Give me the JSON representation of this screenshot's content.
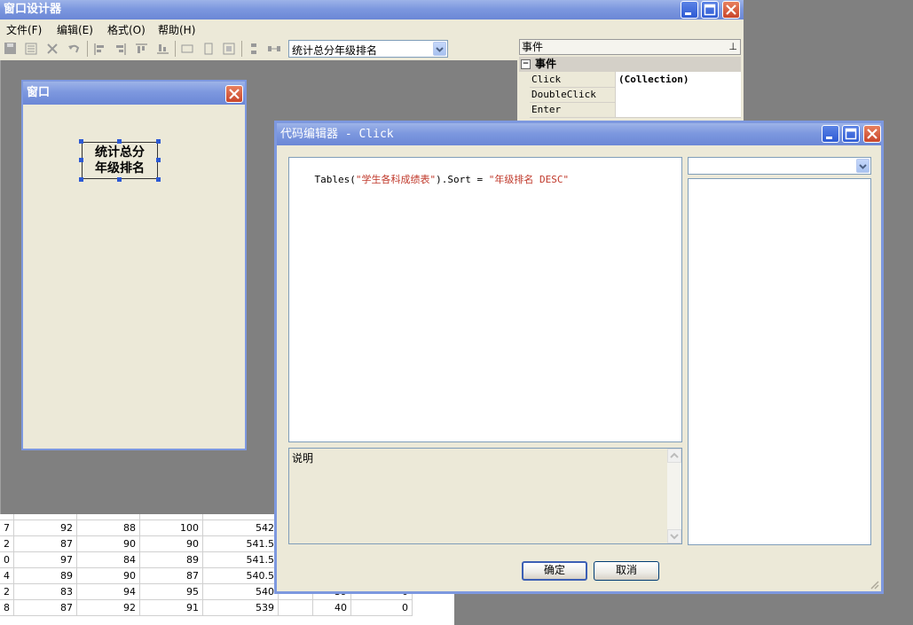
{
  "main_window": {
    "title": "窗口设计器",
    "menu": [
      "文件(F)",
      "编辑(E)",
      "格式(O)",
      "帮助(H)"
    ],
    "toolbar_combo_value": "统计总分年级排名"
  },
  "properties": {
    "header": "事件",
    "category": "事件",
    "pin": "ꟷ",
    "rows": [
      {
        "name": "Click",
        "value": "(Collection)"
      },
      {
        "name": "DoubleClick",
        "value": ""
      },
      {
        "name": "Enter",
        "value": ""
      }
    ]
  },
  "form_window": {
    "title": "窗口",
    "button_line1": "统计总分",
    "button_line2": "年级排名"
  },
  "grid": {
    "top_row_partial": [
      "",
      "",
      "",
      "",
      "",
      "",
      ""
    ],
    "rows": [
      [
        "7",
        "92",
        "88",
        "100",
        "542",
        "",
        "",
        ""
      ],
      [
        "2",
        "87",
        "90",
        "90",
        "541.5",
        "",
        "",
        ""
      ],
      [
        "0",
        "97",
        "84",
        "89",
        "541.5",
        "",
        "",
        ""
      ],
      [
        "4",
        "89",
        "90",
        "87",
        "540.5",
        "",
        "",
        ""
      ],
      [
        "2",
        "83",
        "94",
        "95",
        "540",
        "",
        "39",
        "0"
      ],
      [
        "8",
        "87",
        "92",
        "91",
        "539",
        "",
        "40",
        "0"
      ]
    ]
  },
  "code_editor": {
    "title": "代码编辑器 - Click",
    "code_prefix": "Tables(",
    "code_string1": "\"学生各科成绩表\"",
    "code_middle": ").Sort = ",
    "code_string2": "\"年级排名 DESC\"",
    "description_label": "说明",
    "ok_label": "确定",
    "cancel_label": "取消",
    "combo_value": ""
  },
  "colors": {
    "title_blue": "#7d98df",
    "string_red": "#c0392b",
    "window_bg": "#ece9d8"
  }
}
